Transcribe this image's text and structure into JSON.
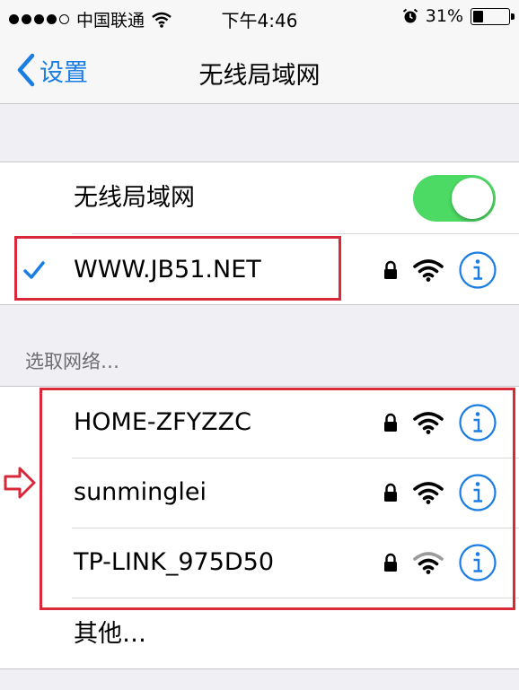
{
  "status_bar": {
    "carrier": "中国联通",
    "time": "下午4:46",
    "battery_percent": "31%",
    "battery_level": 0.31
  },
  "nav": {
    "back_label": "设置",
    "title": "无线局域网"
  },
  "wifi_toggle": {
    "label": "无线局域网",
    "on": true
  },
  "connected_network": {
    "name": "WWW.JB51.NET",
    "secured": true
  },
  "choose_network": {
    "header": "选取网络…",
    "networks": [
      {
        "name": "HOME-ZFYZZC",
        "secured": true
      },
      {
        "name": "sunminglei",
        "secured": true
      },
      {
        "name": "TP-LINK_975D50",
        "secured": true
      }
    ],
    "other_label": "其他…"
  },
  "colors": {
    "accent": "#1a7de3",
    "toggle_on": "#4cd964",
    "annotation_red": "#d9283a",
    "background": "#efeff4"
  }
}
